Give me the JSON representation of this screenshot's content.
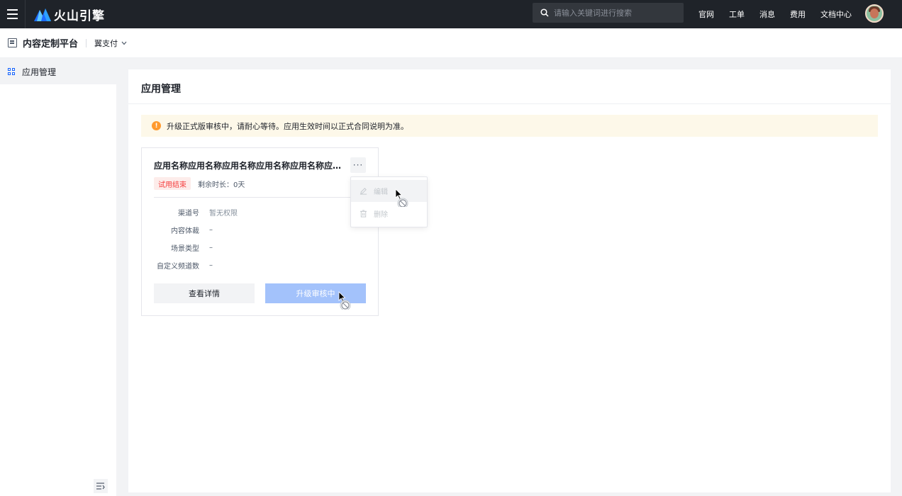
{
  "topnav": {
    "brand": "火山引擎",
    "search_placeholder": "请输入关键词进行搜索",
    "links": [
      "官网",
      "工单",
      "消息",
      "费用",
      "文档中心"
    ]
  },
  "subheader": {
    "platform_title": "内容定制平台",
    "tenant": "翼支付"
  },
  "sidebar": {
    "items": [
      {
        "label": "应用管理",
        "icon": "grid-icon",
        "active": true
      }
    ]
  },
  "main": {
    "title": "应用管理",
    "alert": "升级正式版审核中，请耐心等待。应用生效时间以正式合同说明为准。",
    "card": {
      "title": "应用名称应用名称应用名称应用名称应用名称应用名称",
      "tag": "试用结束",
      "remaining": "剩余时长：0天",
      "fields": [
        {
          "key": "渠道号",
          "value": "暂无权限"
        },
        {
          "key": "内容体裁",
          "value": "–"
        },
        {
          "key": "场景类型",
          "value": "–"
        },
        {
          "key": "自定义频道数",
          "value": "–"
        }
      ],
      "detail_button": "查看详情",
      "upgrade_button": "升级审核中"
    },
    "more_menu": {
      "items": [
        "编辑",
        "删除"
      ]
    }
  },
  "colors": {
    "topbar": "#1f2329",
    "accent": "#1664ff",
    "tag_red": "#f53f3f",
    "alert_bg": "#fdf8e9",
    "disabled_primary": "#a3c2fb"
  }
}
